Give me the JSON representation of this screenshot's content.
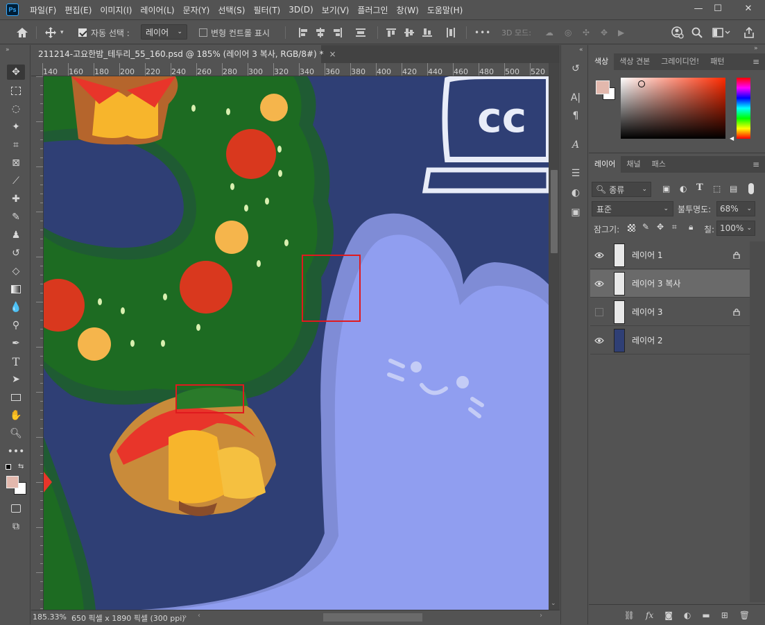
{
  "app": {
    "logo": "Ps"
  },
  "menu": [
    "파일(F)",
    "편집(E)",
    "이미지(I)",
    "레이어(L)",
    "문자(Y)",
    "선택(S)",
    "필터(T)",
    "3D(D)",
    "보기(V)",
    "플러그인",
    "창(W)",
    "도움말(H)"
  ],
  "window_controls": {
    "minimize": "—",
    "maximize": "☐",
    "close": "✕"
  },
  "options": {
    "auto_select_label": "자동 선택 :",
    "auto_select_checked": true,
    "auto_select_target": "레이어",
    "transform_controls_label": "변형 컨트롤 표시",
    "transform_controls_checked": false,
    "more_label": "•••",
    "mode_3d_label": "3D 모드:"
  },
  "document": {
    "tab_title": "211214-고요한밤_테두리_55_160.psd @ 185% (레이어 3 복사, RGB/8#) *",
    "close_glyph": "×",
    "ruler_ticks": [
      "140",
      "160",
      "180",
      "200",
      "220",
      "240",
      "260",
      "280",
      "300",
      "320",
      "340",
      "360",
      "380",
      "400",
      "420",
      "440",
      "460",
      "480",
      "500",
      "520"
    ],
    "zoom": "185.33%",
    "size_info": "650 픽셀 x 1890 픽셀 (300 ppi)",
    "status_arrow": "›"
  },
  "panels": {
    "color_tabs": [
      "색상",
      "색상 견본",
      "그레이디언!",
      "패턴"
    ],
    "layer_tabs": [
      "레이어",
      "채널",
      "패스"
    ],
    "filter_kind": "종류",
    "blend_mode": "표준",
    "opacity_label": "불투명도:",
    "opacity_value": "68%",
    "lock_label": "잠그기:",
    "fill_label": "칠:",
    "fill_value": "100%"
  },
  "layers": [
    {
      "name": "레이어 1",
      "visible": true,
      "locked": true,
      "selected": false
    },
    {
      "name": "레이어 3 복사",
      "visible": true,
      "locked": false,
      "selected": true
    },
    {
      "name": "레이어 3",
      "visible": false,
      "locked": true,
      "selected": false
    },
    {
      "name": "레이어 2",
      "visible": true,
      "locked": false,
      "selected": false
    }
  ],
  "colors": {
    "foreground": "#e2b8ad",
    "background": "#ffffff",
    "canvas_bg": "#2f3f75",
    "selection_box": "#e0191e"
  }
}
